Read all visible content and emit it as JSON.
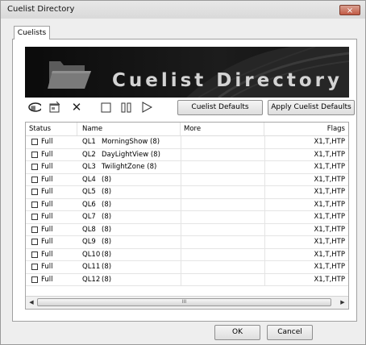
{
  "window": {
    "title": "Cuelist Directory",
    "close_label": "×"
  },
  "tabs": [
    {
      "label": "Cuelists"
    }
  ],
  "banner": {
    "text": "Cuelist Directory"
  },
  "toolbar": {
    "icons": [
      "search-icon",
      "properties-icon",
      "delete-icon",
      "stop-icon",
      "pause-icon",
      "play-icon"
    ],
    "cuelist_defaults_label": "Cuelist Defaults",
    "apply_defaults_label": "Apply Cuelist Defaults"
  },
  "table": {
    "columns": [
      "Status",
      "Name",
      "More",
      "Flags"
    ],
    "rows": [
      {
        "status": "Full",
        "id": "QL1",
        "name": "MorningShow (8)",
        "more": "",
        "flags": "X1,T,HTP"
      },
      {
        "status": "Full",
        "id": "QL2",
        "name": "DayLightView (8)",
        "more": "",
        "flags": "X1,T,HTP"
      },
      {
        "status": "Full",
        "id": "QL3",
        "name": "TwilightZone (8)",
        "more": "",
        "flags": "X1,T,HTP"
      },
      {
        "status": "Full",
        "id": "QL4",
        "name": "(8)",
        "more": "",
        "flags": "X1,T,HTP"
      },
      {
        "status": "Full",
        "id": "QL5",
        "name": "(8)",
        "more": "",
        "flags": "X1,T,HTP"
      },
      {
        "status": "Full",
        "id": "QL6",
        "name": "(8)",
        "more": "",
        "flags": "X1,T,HTP"
      },
      {
        "status": "Full",
        "id": "QL7",
        "name": "(8)",
        "more": "",
        "flags": "X1,T,HTP"
      },
      {
        "status": "Full",
        "id": "QL8",
        "name": "(8)",
        "more": "",
        "flags": "X1,T,HTP"
      },
      {
        "status": "Full",
        "id": "QL9",
        "name": "(8)",
        "more": "",
        "flags": "X1,T,HTP"
      },
      {
        "status": "Full",
        "id": "QL10",
        "name": "(8)",
        "more": "",
        "flags": "X1,T,HTP"
      },
      {
        "status": "Full",
        "id": "QL11",
        "name": "(8)",
        "more": "",
        "flags": "X1,T,HTP"
      },
      {
        "status": "Full",
        "id": "QL12",
        "name": "(8)",
        "more": "",
        "flags": "X1,T,HTP"
      }
    ],
    "scroll_thumb_grip": "III"
  },
  "footer": {
    "ok_label": "OK",
    "cancel_label": "Cancel"
  }
}
